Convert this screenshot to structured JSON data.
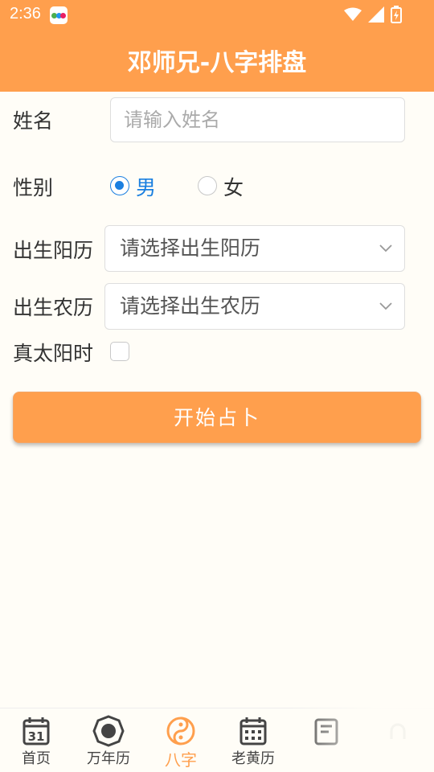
{
  "status_bar": {
    "time": "2:36"
  },
  "header": {
    "title": "邓师兄-八字排盘"
  },
  "form": {
    "name_label": "姓名",
    "name_placeholder": "请输入姓名",
    "gender_label": "性别",
    "gender_options": [
      "男",
      "女"
    ],
    "gender_selected": "男",
    "solar_label": "出生阳历",
    "solar_value": "请选择出生阳历",
    "lunar_label": "出生农历",
    "lunar_value": "请选择出生农历",
    "true_solar_label": "真太阳时",
    "submit_label": "开始占卜"
  },
  "bottom_nav": {
    "items": [
      {
        "label": "首页",
        "icon": "calendar-31-icon"
      },
      {
        "label": "万年历",
        "icon": "bagua-icon"
      },
      {
        "label": "八字",
        "icon": "yin-yang-icon",
        "active": true
      },
      {
        "label": "老黄历",
        "icon": "calendar-grid-icon"
      },
      {
        "label": "",
        "icon": "book-icon"
      },
      {
        "label": "",
        "icon": "user-icon"
      }
    ]
  },
  "colors": {
    "accent": "#ff9f4d",
    "radio_checked": "#1a7fe0"
  }
}
